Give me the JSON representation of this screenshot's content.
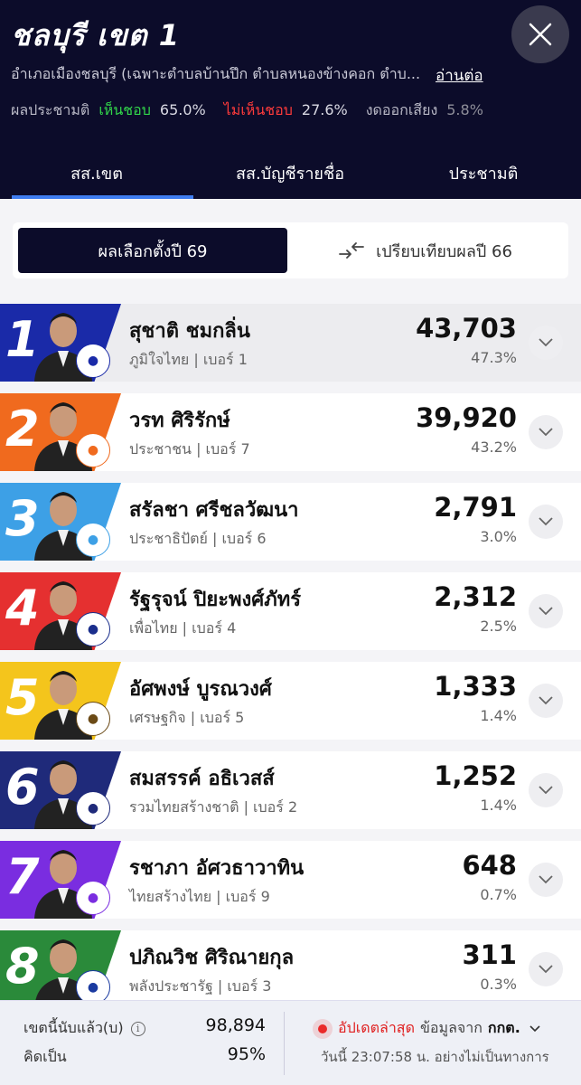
{
  "header": {
    "title": "ชลบุรี เขต 1",
    "description": "อำเภอเมืองชลบุรี (เฉพาะตำบลบ้านปึก ตำบลหนองข้างคอก ตำบ...",
    "read_more": "อ่านต่อ",
    "referendum": {
      "label": "ผลประชามติ",
      "agree_label": "เห็นชอบ",
      "agree_value": "65.0%",
      "disagree_label": "ไม่เห็นชอบ",
      "disagree_value": "27.6%",
      "abstain_label": "งดออกเสียง",
      "abstain_value": "5.8%"
    },
    "tabs": [
      {
        "label": "สส.เขต",
        "active": true
      },
      {
        "label": "สส.บัญชีรายชื่อ",
        "active": false
      },
      {
        "label": "ประชามติ",
        "active": false
      }
    ]
  },
  "toggle": {
    "current_label": "ผลเลือกตั้งปี 69",
    "compare_label": "เปรียบเทียบผลปี 66"
  },
  "candidates": [
    {
      "rank": "1",
      "name": "สุชาติ ชมกลิ่น",
      "party": "ภูมิใจไทย | เบอร์ 1",
      "votes": "43,703",
      "percent": "47.3%",
      "color": "#1a2aa8",
      "logo_color": "#1a2aa8"
    },
    {
      "rank": "2",
      "name": "วรท ศิริรักษ์",
      "party": "ประชาชน | เบอร์ 7",
      "votes": "39,920",
      "percent": "43.2%",
      "color": "#f06a1e",
      "logo_color": "#f06a1e"
    },
    {
      "rank": "3",
      "name": "สรัลชา ศรีชลวัฒนา",
      "party": "ประชาธิปัตย์ | เบอร์ 6",
      "votes": "2,791",
      "percent": "3.0%",
      "color": "#3da0e6",
      "logo_color": "#3da0e6"
    },
    {
      "rank": "4",
      "name": "รัฐรุจน์ ปิยะพงศ์ภัทร์",
      "party": "เพื่อไทย | เบอร์ 4",
      "votes": "2,312",
      "percent": "2.5%",
      "color": "#e53030",
      "logo_color": "#1a2e8c"
    },
    {
      "rank": "5",
      "name": "อัศพงษ์ บูรณวงศ์",
      "party": "เศรษฐกิจ | เบอร์ 5",
      "votes": "1,333",
      "percent": "1.4%",
      "color": "#f4c51c",
      "logo_color": "#6b4a16"
    },
    {
      "rank": "6",
      "name": "สมสรรค์ อธิเวสส์",
      "party": "รวมไทยสร้างชาติ | เบอร์ 2",
      "votes": "1,252",
      "percent": "1.4%",
      "color": "#1f2a7a",
      "logo_color": "#1f2a7a"
    },
    {
      "rank": "7",
      "name": "รชาภา อัศวธาวาทิน",
      "party": "ไทยสร้างไทย | เบอร์ 9",
      "votes": "648",
      "percent": "0.7%",
      "color": "#7a2de0",
      "logo_color": "#7a2de0"
    },
    {
      "rank": "8",
      "name": "ปภิณวิช ศิริณายกุล",
      "party": "พลังประชารัฐ | เบอร์ 3",
      "votes": "311",
      "percent": "0.3%",
      "color": "#2a8a3a",
      "logo_color": "#1a3aa0"
    }
  ],
  "footer": {
    "counted_label": "เขตนี้นับแล้ว(บ)",
    "counted_value": "98,894",
    "percent_label": "คิดเป็น",
    "percent_value": "95%",
    "update_label": "อัปเดตล่าสุด",
    "source_label": "ข้อมูลจาก",
    "source_org": "กกต.",
    "timestamp": "วันนี้ 23:07:58 น. อย่างไม่เป็นทางการ"
  }
}
